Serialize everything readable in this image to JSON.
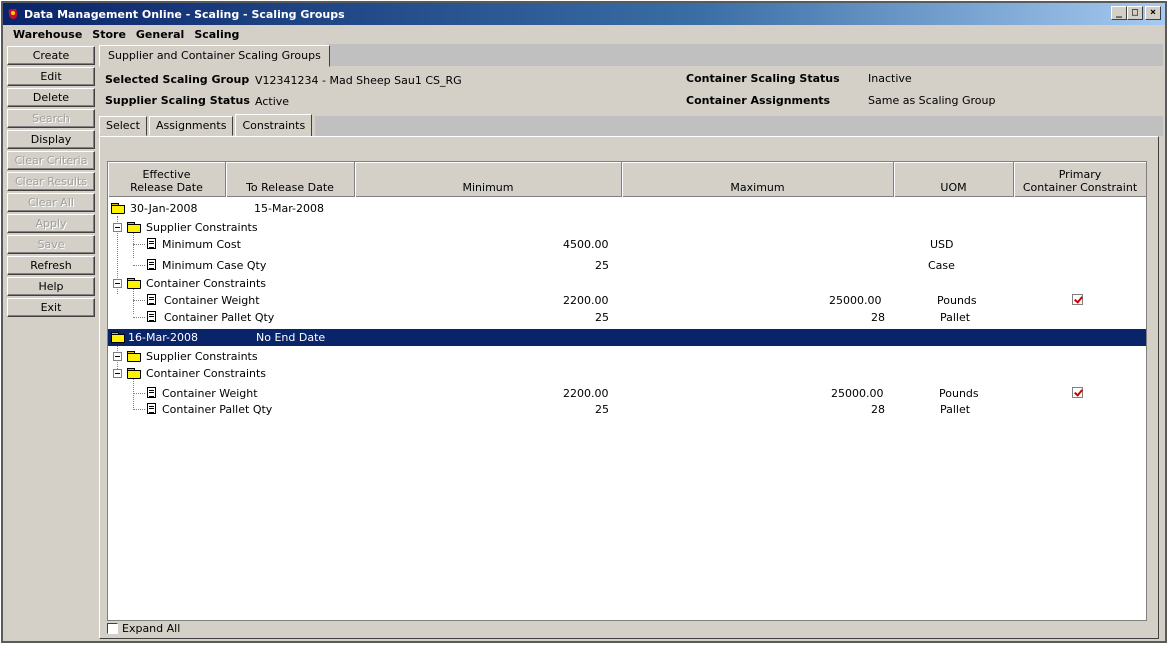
{
  "window": {
    "title": "Data Management Online - Scaling - Scaling Groups",
    "buttons": {
      "minimize": "_",
      "maximize": "□",
      "close": "×"
    }
  },
  "menu": {
    "items": [
      "Warehouse",
      "Store",
      "General",
      "Scaling"
    ]
  },
  "sidebar": {
    "buttons": [
      {
        "label": "Create",
        "enabled": true
      },
      {
        "label": "Edit",
        "enabled": true
      },
      {
        "label": "Delete",
        "enabled": true
      },
      {
        "label": "Search",
        "enabled": false
      },
      {
        "label": "Display",
        "enabled": true
      },
      {
        "label": "Clear Criteria",
        "enabled": false
      },
      {
        "label": "Clear Results",
        "enabled": false
      },
      {
        "label": "Clear All",
        "enabled": false
      },
      {
        "label": "Apply",
        "enabled": false
      },
      {
        "label": "Save",
        "enabled": false
      },
      {
        "label": "Refresh",
        "enabled": true
      },
      {
        "label": "Help",
        "enabled": true
      },
      {
        "label": "Exit",
        "enabled": true
      }
    ]
  },
  "main_tab": {
    "label": "Supplier and Container Scaling Groups"
  },
  "info": {
    "selected_group_label": "Selected Scaling Group",
    "selected_group_value": "V12341234 - Mad Sheep Sau1 CS_RG",
    "supplier_status_label": "Supplier Scaling Status",
    "supplier_status_value": "Active",
    "container_status_label": "Container Scaling Status",
    "container_status_value": "Inactive",
    "container_assign_label": "Container Assignments",
    "container_assign_value": "Same as Scaling Group"
  },
  "sub_tabs": [
    {
      "label": "Select",
      "active": false
    },
    {
      "label": "Assignments",
      "active": false
    },
    {
      "label": "Constraints",
      "active": true
    }
  ],
  "grid": {
    "headers": {
      "effective_line1": "Effective",
      "effective_line2": "Release Date",
      "to_release": "To Release Date",
      "minimum": "Minimum",
      "maximum": "Maximum",
      "uom": "UOM",
      "primary_line1": "Primary",
      "primary_line2": "Container Constraint"
    },
    "groups": [
      {
        "from": "30-Jan-2008",
        "to": "15-Mar-2008",
        "selected": false,
        "supplier_label": "Supplier Constraints",
        "supplier_rows": [
          {
            "name": "Minimum Cost",
            "min": "4500.00",
            "max": "",
            "uom": "USD",
            "primary": false
          },
          {
            "name": "Minimum Case Qty",
            "min": "25",
            "max": "",
            "uom": "Case",
            "primary": false
          }
        ],
        "container_label": "Container Constraints",
        "container_rows": [
          {
            "name": "Container Weight",
            "min": "2200.00",
            "max": "25000.00",
            "uom": "Pounds",
            "primary": true
          },
          {
            "name": "Container Pallet Qty",
            "min": "25",
            "max": "28",
            "uom": "Pallet",
            "primary": false
          }
        ]
      },
      {
        "from": "16-Mar-2008",
        "to": "No End Date",
        "selected": true,
        "supplier_label": "Supplier Constraints",
        "supplier_rows": [],
        "container_label": "Container Constraints",
        "container_rows": [
          {
            "name": "Container Weight",
            "min": "2200.00",
            "max": "25000.00",
            "uom": "Pounds",
            "primary": true
          },
          {
            "name": "Container Pallet Qty",
            "min": "25",
            "max": "28",
            "uom": "Pallet",
            "primary": false
          }
        ]
      }
    ]
  },
  "expand_all": {
    "label": "Expand All",
    "checked": false
  },
  "colors": {
    "selection": "#0a246a",
    "check": "#d00000",
    "face": "#d4d0c8"
  }
}
